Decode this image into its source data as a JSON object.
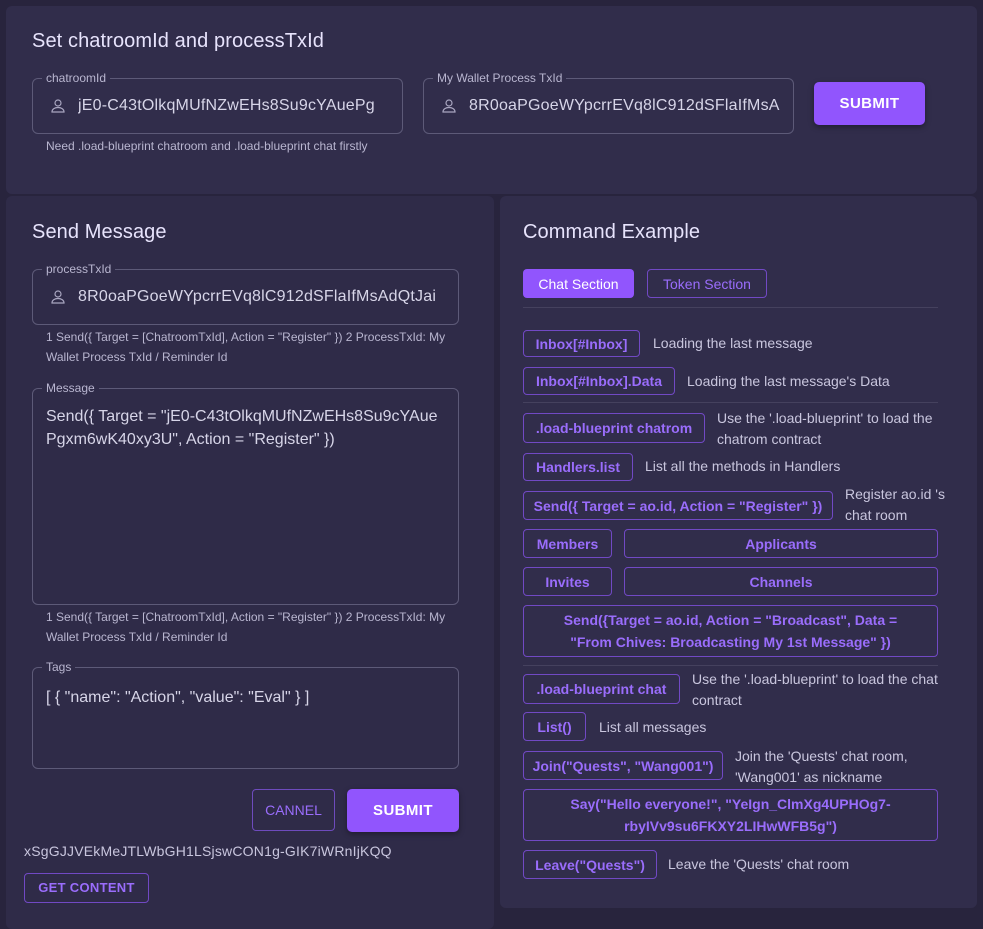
{
  "top": {
    "title": "Set chatroomId and processTxId",
    "chatroom": {
      "legend": "chatroomId",
      "value": "jE0-C43tOlkqMUfNZwEHs8Su9cYAuePg"
    },
    "wallet": {
      "legend": "My Wallet Process TxId",
      "value": "8R0oaPGoeWYpcrrEVq8lC912dSFlaIfMsA"
    },
    "helper": "Need .load-blueprint chatroom and .load-blueprint chat firstly",
    "submit_label": "SUBMIT"
  },
  "send": {
    "title": "Send Message",
    "process": {
      "legend": "processTxId",
      "value": "8R0oaPGoeWYpcrrEVq8lC912dSFlaIfMsAdQtJai"
    },
    "process_helper": "1 Send({ Target = [ChatroomTxId], Action = \"Register\" }) 2 ProcessTxId: My Wallet Process TxId / Reminder Id",
    "message": {
      "legend": "Message",
      "value": "Send({ Target = \"jE0-C43tOlkqMUfNZwEHs8Su9cYAuePgxm6wK40xy3U\", Action = \"Register\" })"
    },
    "message_helper": "1 Send({ Target = [ChatroomTxId], Action = \"Register\" }) 2 ProcessTxId: My Wallet Process TxId / Reminder Id",
    "tags": {
      "legend": "Tags",
      "value": "[ { \"name\": \"Action\", \"value\": \"Eval\" } ]"
    },
    "cancel_label": "CANNEL",
    "submit_label": "SUBMIT",
    "result_text": "xSgGJJVEkMeJTLWbGH1LSjswCON1g-GIK7iWRnIjKQQ",
    "get_content_label": "GET CONTENT"
  },
  "commands": {
    "title": "Command Example",
    "tabs": [
      "Chat Section",
      "Token Section"
    ],
    "items": {
      "inbox": "Inbox[#Inbox]",
      "inbox_desc": "Loading the last message",
      "inbox_data": "Inbox[#Inbox].Data",
      "inbox_data_desc": "Loading the last message's Data",
      "load_chatroom": ".load-blueprint chatrom",
      "load_chatroom_desc": "Use the '.load-blueprint' to load the chatrom contract",
      "handlers": "Handlers.list",
      "handlers_desc": "List all the methods in Handlers",
      "register": "Send({ Target = ao.id, Action = \"Register\" })",
      "register_desc": "Register ao.id 's chat room",
      "members": "Members",
      "applicants": "Applicants",
      "invites": "Invites",
      "channels": "Channels",
      "broadcast": "Send({Target = ao.id, Action = \"Broadcast\", Data = \"From Chives: Broadcasting My 1st Message\" })",
      "load_chat": ".load-blueprint chat",
      "load_chat_desc": "Use the '.load-blueprint' to load the chat contract",
      "list": "List()",
      "list_desc": "List all messages",
      "join": "Join(\"Quests\", \"Wang001\")",
      "join_desc": "Join the 'Quests' chat room, 'Wang001' as nickname",
      "say": "Say(\"Hello everyone!\", \"YeIgn_ClmXg4UPHOg7-rbyIVv9su6FKXY2LIHwWFB5g\")",
      "leave": "Leave(\"Quests\")",
      "leave_desc": "Leave the 'Quests' chat room"
    }
  },
  "colors": {
    "accent": "#9155fd",
    "background": "#28243d",
    "card": "#312d4b"
  }
}
